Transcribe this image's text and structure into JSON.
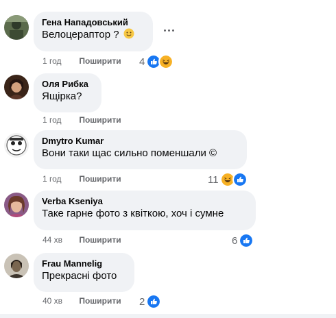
{
  "colors": {
    "like": "#1877f2",
    "haha": "#f7b125",
    "bubble": "#f0f2f5",
    "meta": "#65676b"
  },
  "share_label": "Поширити",
  "comments": [
    {
      "author": "Гена Нападовський",
      "text": "Велоцераптор ?",
      "time": "1 год",
      "reaction_count": "4",
      "reactions": [
        "like-icon",
        "haha-icon"
      ],
      "emoji": "slightly-smiling-face-icon"
    },
    {
      "author": "Оля Рибка",
      "text": "Ящірка?",
      "time": "1 год",
      "reaction_count": "",
      "reactions": []
    },
    {
      "author": "Dmytro Kumar",
      "text": "Вони таки щас сильно поменшали ©",
      "time": "1 год",
      "reaction_count": "11",
      "reactions": [
        "haha-icon",
        "like-icon"
      ]
    },
    {
      "author": "Verba Kseniya",
      "text": "Таке гарне фото з квіткою, хоч і сумне",
      "time": "44 хв",
      "reaction_count": "6",
      "reactions": [
        "like-icon"
      ]
    },
    {
      "author": "Frau Mannelig",
      "text": "Прекрасні фото",
      "time": "40 хв",
      "reaction_count": "2",
      "reactions": [
        "like-icon"
      ]
    }
  ]
}
